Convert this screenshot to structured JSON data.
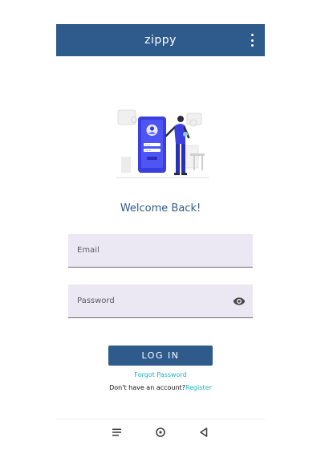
{
  "app": {
    "title": "zippy"
  },
  "welcome": "Welcome Back!",
  "form": {
    "email_placeholder": "Email",
    "email_value": "",
    "password_placeholder": "Password",
    "password_value": "",
    "login_label": "LOG IN",
    "forgot_label": "Forgot Password",
    "no_account_text": "Don't have an account?",
    "register_label": "Register"
  },
  "icons": {
    "overflow": "more-vert-icon",
    "visibility": "eye-icon",
    "nav_menu": "menu-lines-icon",
    "nav_home": "circle-home-icon",
    "nav_back": "triangle-back-icon"
  },
  "colors": {
    "primary": "#2f5b8c",
    "accent": "#21b2c4",
    "field_bg": "#ece8f3"
  }
}
